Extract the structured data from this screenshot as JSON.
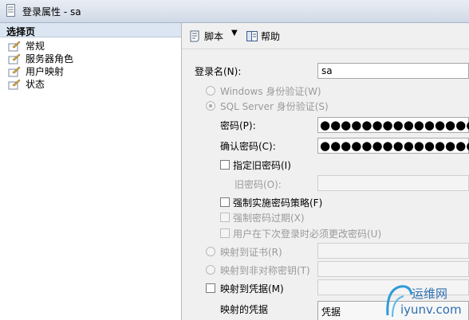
{
  "window": {
    "title": "登录属性 - sa"
  },
  "left_pane": {
    "header": "选择页",
    "items": [
      {
        "label": "常规"
      },
      {
        "label": "服务器角色"
      },
      {
        "label": "用户映射"
      },
      {
        "label": "状态"
      }
    ]
  },
  "toolbar": {
    "script_label": "脚本",
    "help_label": "帮助"
  },
  "form": {
    "login_name_label": "登录名(N):",
    "login_name_value": "sa",
    "windows_auth_label": "Windows 身份验证(W)",
    "sql_auth_label": "SQL Server 身份验证(S)",
    "password_label": "密码(P):",
    "password_value": "●●●●●●●●●●●●●●●",
    "confirm_password_label": "确认密码(C):",
    "confirm_password_value": "●●●●●●●●●●●●●●●",
    "specify_old_password_label": "指定旧密码(I)",
    "old_password_label": "旧密码(O):",
    "enforce_policy_label": "强制实施密码策略(F)",
    "enforce_expiration_label": "强制密码过期(X)",
    "must_change_label": "用户在下次登录时必须更改密码(U)",
    "map_certificate_label": "映射到证书(R)",
    "map_asymmetric_key_label": "映射到非对称密钥(T)",
    "map_credential_label": "映射到凭据(M)",
    "mapped_credentials_label": "映射的凭据",
    "credential_column_label": "凭据"
  },
  "watermark": {
    "text1": "运维网",
    "text2": "iyunv.com"
  }
}
